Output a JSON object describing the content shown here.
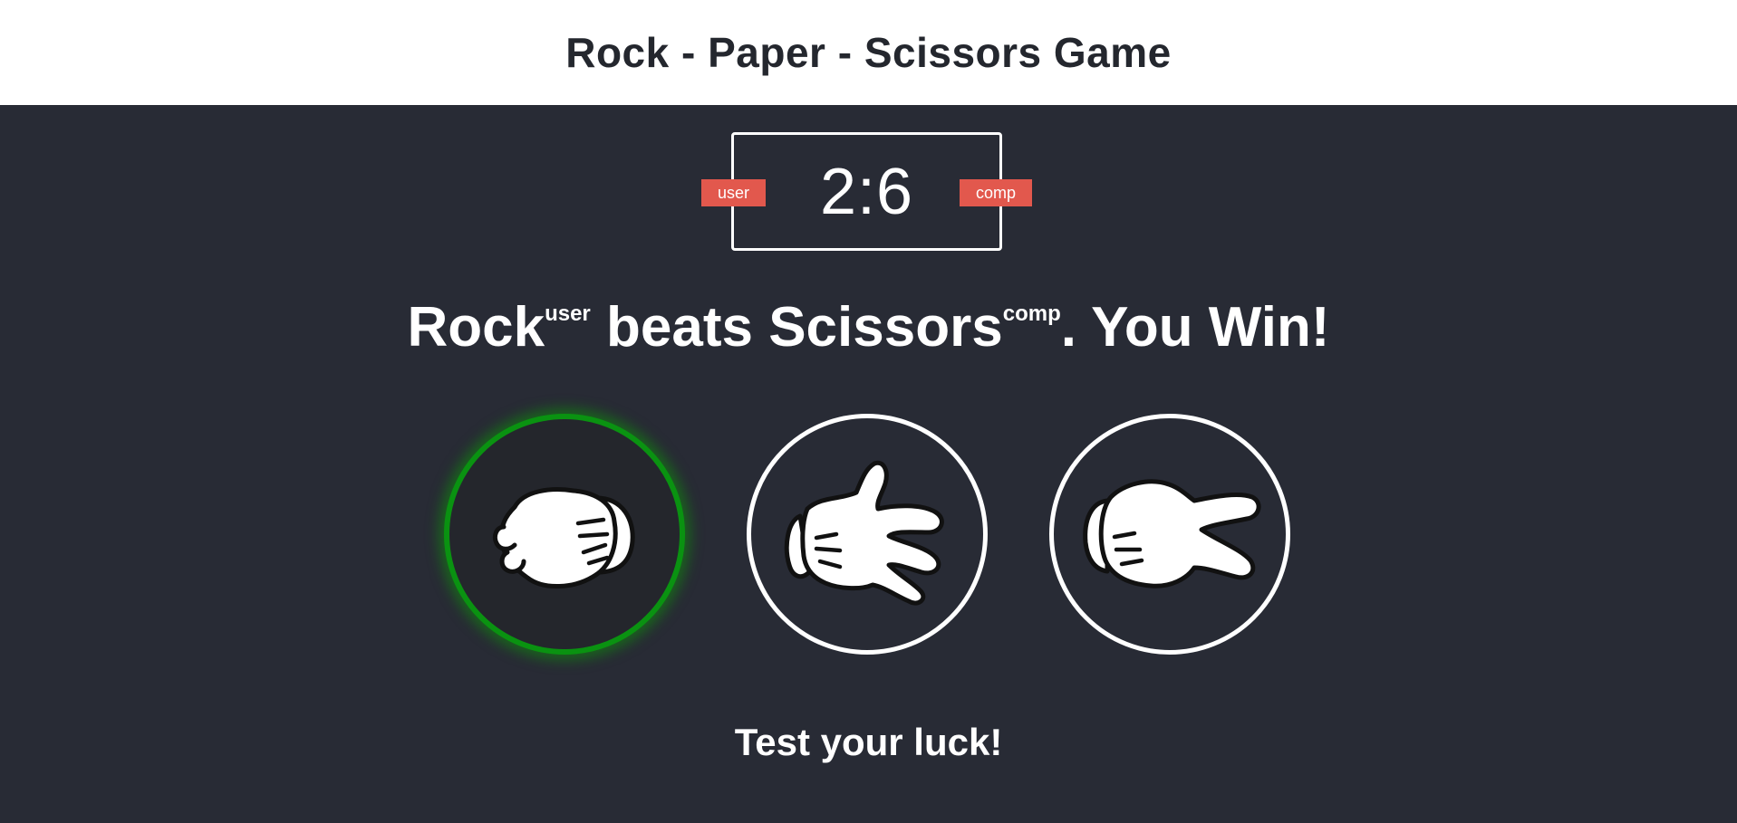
{
  "header": {
    "title": "Rock - Paper - Scissors Game"
  },
  "scoreboard": {
    "score": "2:6",
    "user_label": "user",
    "comp_label": "comp",
    "badge_color": "#e2584d"
  },
  "result": {
    "user_choice": "Rock",
    "user_tag": "user",
    "verb": " beats ",
    "comp_choice": "Scissors",
    "comp_tag": "comp",
    "outcome": ". You Win!"
  },
  "choices": [
    {
      "id": "rock",
      "icon": "rock-hand-icon",
      "state": "win",
      "highlight_color": "#0a9211"
    },
    {
      "id": "paper",
      "icon": "paper-hand-icon",
      "state": "normal"
    },
    {
      "id": "scissors",
      "icon": "scissors-hand-icon",
      "state": "normal"
    }
  ],
  "footer": {
    "message": "Test your luck!"
  }
}
